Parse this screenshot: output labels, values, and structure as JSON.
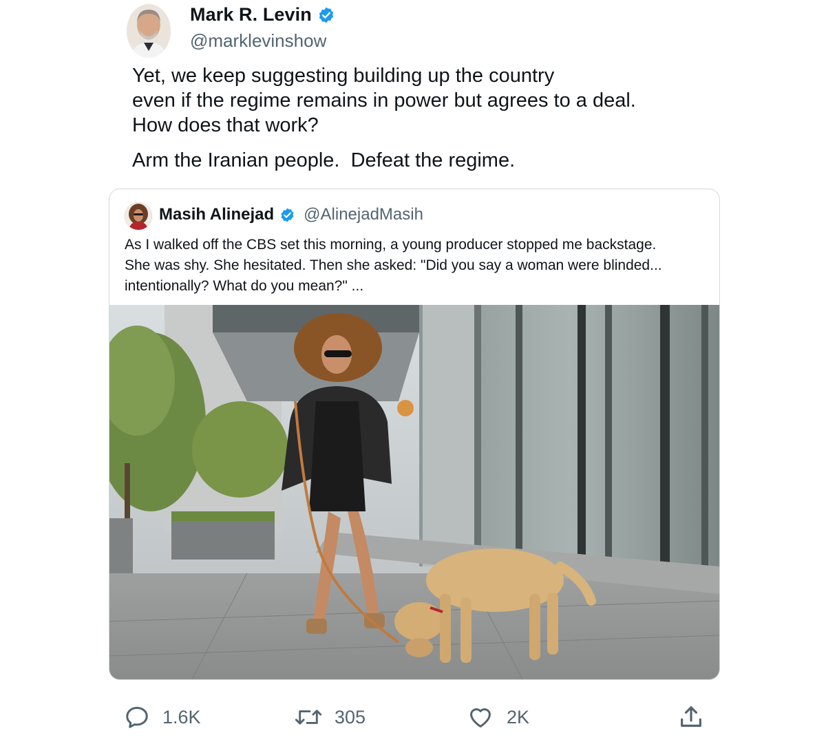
{
  "author": {
    "name": "Mark R. Levin",
    "handle": "@marklevinshow",
    "verified": true
  },
  "tweet": {
    "lines": [
      "Yet, we keep suggesting building up the country",
      "even if the regime remains in power but agrees to a deal.",
      "How does that work?"
    ],
    "second_paragraph": "Arm the Iranian people.  Defeat the regime."
  },
  "quote": {
    "name": "Masih Alinejad",
    "handle": "@AlinejadMasih",
    "verified": true,
    "lines": [
      "As I walked off the CBS set this morning, a young producer stopped me backstage.",
      "She was shy. She hesitated. Then she asked: \"Did you say a woman were blinded...",
      "intentionally? What do you mean?\" ..."
    ]
  },
  "actions": {
    "replies": "1.6K",
    "retweets": "305",
    "likes": "2K"
  },
  "colors": {
    "verified": "#1d9bf0",
    "secondary_text": "#536471",
    "border": "#cfd9de"
  },
  "icons": [
    "verified-badge-icon",
    "reply-icon",
    "retweet-icon",
    "like-icon",
    "share-icon"
  ]
}
